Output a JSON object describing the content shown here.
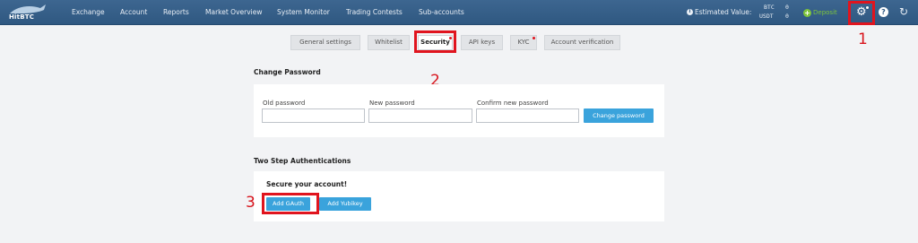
{
  "header": {
    "logo_text": "HitBTC",
    "nav": [
      {
        "label": "Exchange"
      },
      {
        "label": "Account"
      },
      {
        "label": "Reports"
      },
      {
        "label": "Market Overview"
      },
      {
        "label": "System Monitor"
      },
      {
        "label": "Trading Contests"
      },
      {
        "label": "Sub-accounts"
      }
    ],
    "estimated_label": "Estimated Value:",
    "balances": [
      {
        "currency": "BTC",
        "amount": "0"
      },
      {
        "currency": "USDT",
        "amount": "0"
      }
    ],
    "deposit_label": "Deposit"
  },
  "tabs": [
    {
      "label": "General settings",
      "active": false,
      "dot": false
    },
    {
      "label": "Whitelist",
      "active": false,
      "dot": false
    },
    {
      "label": "Security",
      "active": true,
      "dot": true
    },
    {
      "label": "API keys",
      "active": false,
      "dot": false
    },
    {
      "label": "KYC",
      "active": false,
      "dot": true
    },
    {
      "label": "Account verification",
      "active": false,
      "dot": false
    }
  ],
  "change_password": {
    "title": "Change Password",
    "old_label": "Old password",
    "old_value": "",
    "new_label": "New password",
    "new_value": "",
    "confirm_label": "Confirm new password",
    "confirm_value": "",
    "button": "Change password"
  },
  "two_step": {
    "title": "Two Step Authentications",
    "secure_text": "Secure your account!",
    "gauth_button": "Add GAuth",
    "yubikey_button": "Add Yubikey"
  },
  "annotations": {
    "n1": "1",
    "n2": "2",
    "n3": "3"
  },
  "colors": {
    "header_bg": "#2f5881",
    "accent_button": "#3aa3dc",
    "highlight": "#e0141e",
    "deposit": "#7ec43c"
  },
  "icons": {
    "settings": "gear-icon",
    "help": "help-icon",
    "logout": "logout-icon",
    "deposit": "plus-circle-icon",
    "info": "info-icon"
  }
}
